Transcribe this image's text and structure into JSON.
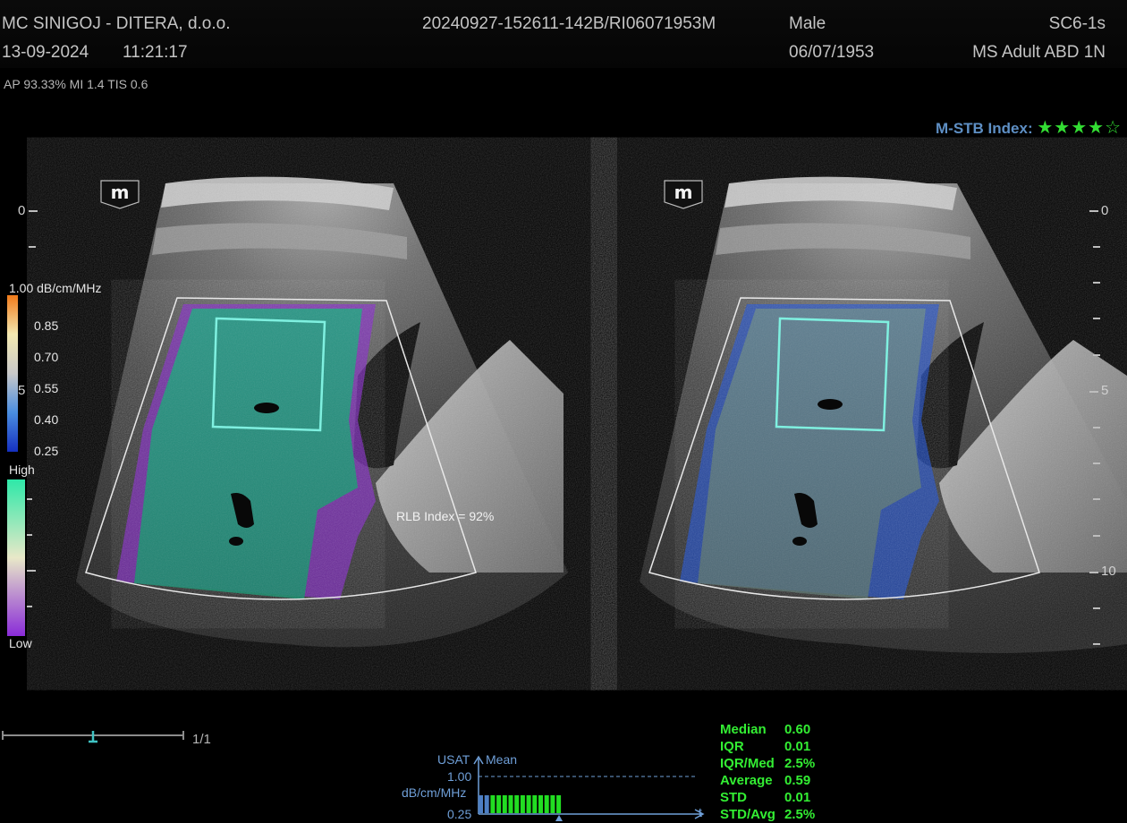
{
  "header": {
    "institution": "MC SINIGOJ - DITERA, d.o.o.",
    "date": "13-09-2024",
    "time": "11:21:17",
    "exam_id": "20240927-152611-142B/RI06071953M",
    "sex": "Male",
    "dob": "06/07/1953",
    "probe": "SC6-1s",
    "preset": "MS Adult ABD 1N"
  },
  "acoustic": "AP 93.33%  MI 1.4 TIS 0.6",
  "stb": {
    "label": "M-STB Index:",
    "stars_filled": "★★★★",
    "stars_empty": "☆",
    "rating": 4,
    "max": 5
  },
  "depth_labels": {
    "left_zero": "0",
    "right_zero": "0",
    "five_left": "5",
    "five_right": "5",
    "ten": "10"
  },
  "atten_scale": {
    "title": "1.00 dB/cm/MHz",
    "ticks": [
      "0.85",
      "0.70",
      "0.55",
      "0.40",
      "0.25"
    ]
  },
  "reliability_scale": {
    "high": "High",
    "low": "Low"
  },
  "rlb_index": "RLB Index = 92%",
  "cine": {
    "counter": "1/1"
  },
  "graph": {
    "axis_label": "USAT",
    "series_label": "Mean",
    "unit": "dB/cm/MHz",
    "ymax": "1.00",
    "ymin": "0.25",
    "axis_t": "t"
  },
  "stats": [
    {
      "label": "Median",
      "value": "0.60"
    },
    {
      "label": "IQR",
      "value": "0.01"
    },
    {
      "label": "IQR/Med",
      "value": "2.5%"
    },
    {
      "label": "Average",
      "value": "0.59"
    },
    {
      "label": "STD",
      "value": "0.01"
    },
    {
      "label": "STD/Avg",
      "value": "2.5%"
    }
  ],
  "colors": {
    "stats_green": "#33ee33",
    "label_blue": "#6f9fd8",
    "roi_cyan": "#7ff0e0"
  }
}
